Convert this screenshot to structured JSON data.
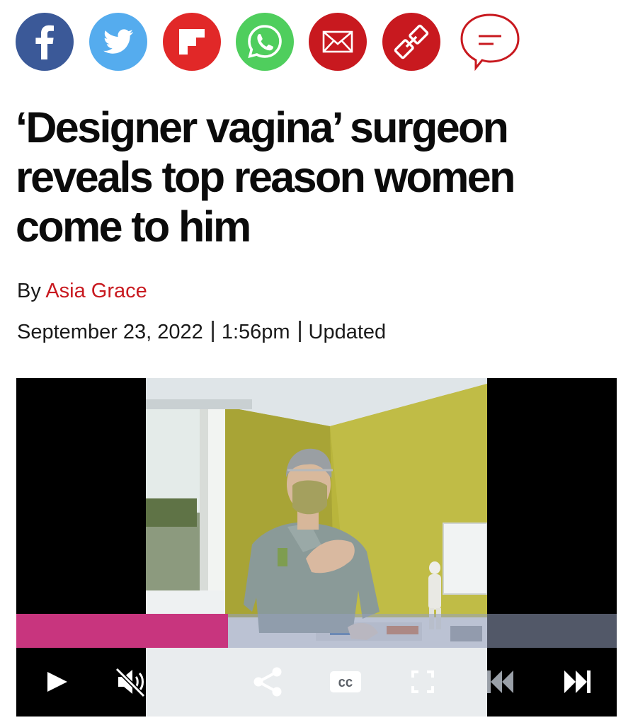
{
  "share": {
    "colors": {
      "facebook": "#3b5998",
      "twitter": "#55acee",
      "flipboard": "#e12828",
      "whatsapp": "#4fce5d",
      "email": "#c8191f",
      "link": "#c8191f",
      "comment": "#c8191f"
    },
    "icons": [
      "facebook-icon",
      "twitter-icon",
      "flipboard-icon",
      "whatsapp-icon",
      "email-icon",
      "link-icon",
      "comment-icon"
    ]
  },
  "article": {
    "headline": "‘Designer vagina’ surgeon reveals top reason women come to him",
    "byline_prefix": "By",
    "author": "Asia Grace",
    "date": "September 23, 2022",
    "time": "1:56pm",
    "updated_label": "Updated"
  },
  "video": {
    "progress_fraction": 0.353,
    "progress_color": "#c8357e",
    "cc_label": "CC",
    "controls": [
      "play-icon",
      "mute-icon",
      "share-icon",
      "closed-captions-icon",
      "fullscreen-icon",
      "skip-back-icon",
      "skip-forward-icon"
    ]
  }
}
